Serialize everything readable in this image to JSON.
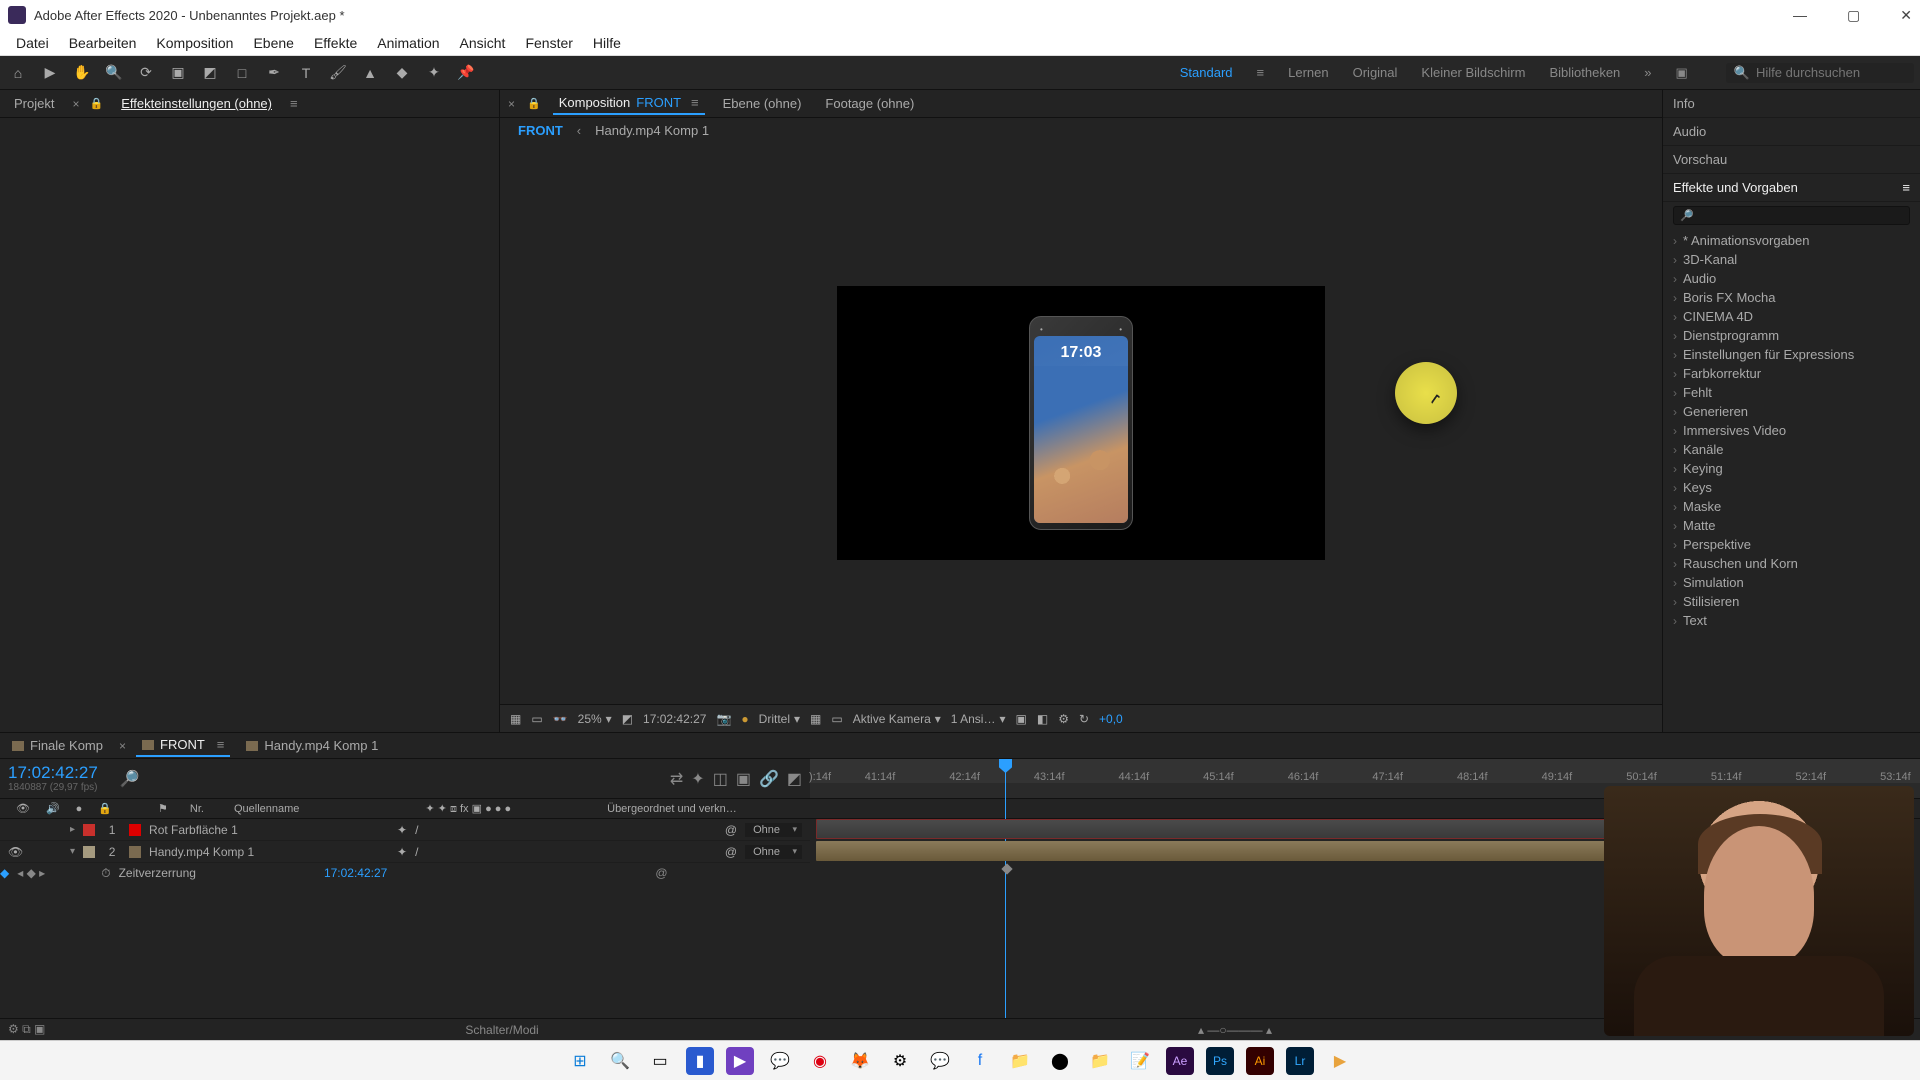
{
  "titlebar": {
    "title": "Adobe After Effects 2020 - Unbenanntes Projekt.aep *"
  },
  "menu": [
    "Datei",
    "Bearbeiten",
    "Komposition",
    "Ebene",
    "Effekte",
    "Animation",
    "Ansicht",
    "Fenster",
    "Hilfe"
  ],
  "workspaces": {
    "standard": "Standard",
    "lernen": "Lernen",
    "original": "Original",
    "klein": "Kleiner Bildschirm",
    "bib": "Bibliotheken",
    "search_placeholder": "Hilfe durchsuchen"
  },
  "left_tabs": {
    "projekt": "Projekt",
    "effect_settings": "Effekteinstellungen (ohne)"
  },
  "viewer": {
    "tabs": {
      "komposition_label": "Komposition",
      "komposition_name": "FRONT",
      "ebene": "Ebene (ohne)",
      "footage": "Footage (ohne)"
    },
    "breadcrumb": {
      "active": "FRONT",
      "comp": "Handy.mp4 Komp 1"
    },
    "phone_time": "17:03",
    "controls": {
      "zoom": "25%",
      "timecode": "17:02:42:27",
      "mode": "Drittel",
      "camera": "Aktive Kamera",
      "views": "1 Ansi…",
      "offset": "+0,0"
    }
  },
  "right": {
    "info": "Info",
    "audio": "Audio",
    "vorschau": "Vorschau",
    "effects_header": "Effekte und Vorgaben",
    "effects": [
      "* Animationsvorgaben",
      "3D-Kanal",
      "Audio",
      "Boris FX Mocha",
      "CINEMA 4D",
      "Dienstprogramm",
      "Einstellungen für Expressions",
      "Farbkorrektur",
      "Fehlt",
      "Generieren",
      "Immersives Video",
      "Kanäle",
      "Keying",
      "Keys",
      "Maske",
      "Matte",
      "Perspektive",
      "Rauschen und Korn",
      "Simulation",
      "Stilisieren",
      "Text"
    ]
  },
  "timeline": {
    "tabs": {
      "finale": "Finale Komp",
      "front": "FRONT",
      "handy": "Handy.mp4 Komp 1"
    },
    "timecode": "17:02:42:27",
    "sub": "1840887 (29,97 fps)",
    "cols": {
      "nr": "Nr.",
      "name": "Quellenname",
      "parent": "Übergeordnet und verkn…"
    },
    "ticks": [
      "41:14f",
      "42:14f",
      "43:14f",
      "44:14f",
      "45:14f",
      "46:14f",
      "47:14f",
      "48:14f",
      "49:14f",
      "50:14f",
      "51:14f",
      "52:14f",
      "53:14f"
    ],
    "tick_start": "):14f",
    "layers": [
      {
        "num": "1",
        "name": "Rot Farbfläche 1",
        "mode": "Ohne"
      },
      {
        "num": "2",
        "name": "Handy.mp4 Komp 1",
        "mode": "Ohne"
      }
    ],
    "prop": {
      "label": "Zeitverzerrung",
      "value": "17:02:42:27"
    },
    "footer": "Schalter/Modi"
  }
}
